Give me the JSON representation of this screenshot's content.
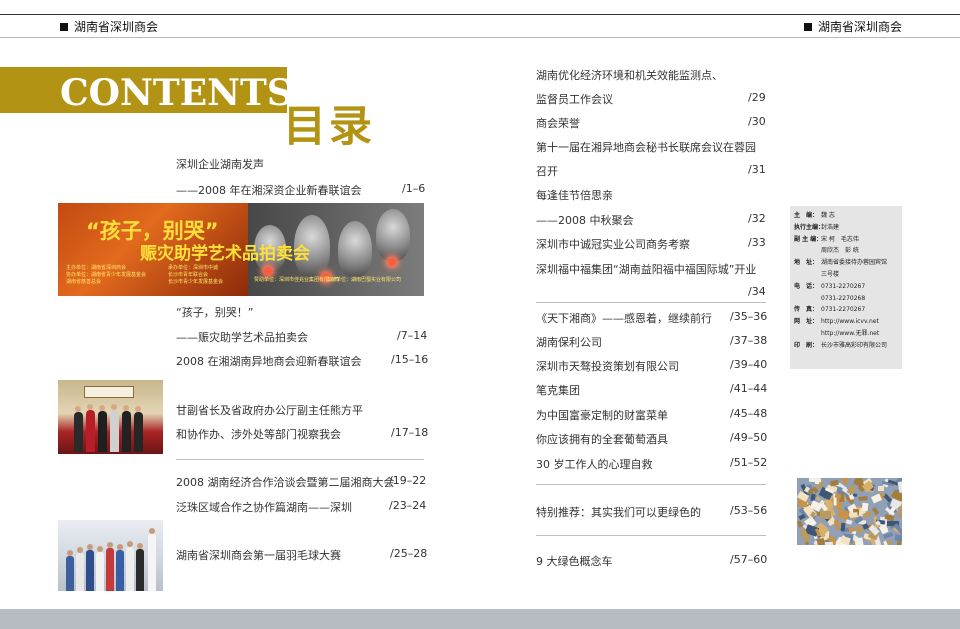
{
  "header": {
    "left_title": "湖南省深圳商会",
    "right_title": "湖南省深圳商会"
  },
  "title": {
    "contents": "CONTENTS",
    "mulu": "目录"
  },
  "left_entries": [
    {
      "title": "深圳企业湖南发声",
      "page": ""
    },
    {
      "title": "——2008 年在湘深资企业新春联谊会",
      "page": "/1–6"
    },
    {
      "title": "“孩子，别哭！”",
      "page": ""
    },
    {
      "title": "——赈灾助学艺术品拍卖会",
      "page": "/7–14"
    },
    {
      "title": "2008 在湘湖南异地商会迎新春联谊会",
      "page": "/15–16"
    },
    {
      "title": "甘副省长及省政府办公厅副主任熊方平",
      "page": ""
    },
    {
      "title": "和协作办、涉外处等部门视察我会",
      "page": "/17–18"
    },
    {
      "title": "2008 湖南经济合作洽谈会暨第二届湘商大会",
      "page": "/19–22"
    },
    {
      "title": "泛珠区域合作之协作篇湖南——深圳",
      "page": "/23–24"
    },
    {
      "title": "湖南省深圳商会第一届羽毛球大赛",
      "page": "/25–28"
    }
  ],
  "right_entries": [
    {
      "title": "湖南优化经济环境和机关效能监测点、",
      "page": ""
    },
    {
      "title": "监督员工作会议",
      "page": "/29"
    },
    {
      "title": "商会荣誉",
      "page": "/30"
    },
    {
      "title": "第十一届在湘异地商会秘书长联席会议在蓉园",
      "page": ""
    },
    {
      "title": "召开",
      "page": "/31"
    },
    {
      "title": "每逢佳节倍思亲",
      "page": ""
    },
    {
      "title": "——2008 中秋聚会",
      "page": "/32"
    },
    {
      "title": "深圳市中诚冠实业公司商务考察",
      "page": "/33"
    },
    {
      "title": "深圳福中福集团“湖南益阳福中福国际城”开业",
      "page": ""
    },
    {
      "title": "",
      "page": "/34"
    },
    {
      "title": "《天下湘商》——感恩着，继续前行",
      "page": "/35–36"
    },
    {
      "title": "湖南保利公司",
      "page": "/37–38"
    },
    {
      "title": "深圳市天骜投资策划有限公司",
      "page": "/39–40"
    },
    {
      "title": "笔克集团",
      "page": "/41–44"
    },
    {
      "title": "为中国富豪定制的财富菜单",
      "page": "/45–48"
    },
    {
      "title": "你应该拥有的全套葡萄酒具",
      "page": "/49–50"
    },
    {
      "title": "30 岁工作人的心理自救",
      "page": "/51–52"
    },
    {
      "title": "特别推荐：其实我们可以更绿色的",
      "page": "/53–56"
    },
    {
      "title": "9 大绿色概念车",
      "page": "/57–60"
    }
  ],
  "banner": {
    "line1": "“孩子，别哭”",
    "line2": "赈灾助学艺术品拍卖会",
    "small_left": [
      "主办单位：湖南省深圳商会",
      "协办单位：湖南省青少年发展基金会",
      "湖南省慈善总会"
    ],
    "small_mid": [
      "承办单位：深圳市中诚",
      "长沙市青年联合会",
      "长沙市青少年发展基金会"
    ],
    "small_mid2": [
      "赞助单位：深圳市佳兆业集团有限公司"
    ],
    "small_right": [
      "支持单位：湖南巴蜀实业有限公司"
    ]
  },
  "credits": [
    {
      "k": "主　编：",
      "v": "魏 志"
    },
    {
      "k": "执行主编：",
      "v": "封浩建"
    },
    {
      "k": "副 主 编：",
      "v": "宋 柯　毛志伟"
    },
    {
      "k": "",
      "v": "周欣杰　彭 统"
    },
    {
      "k": "地　址：",
      "v": "湖南省委接待办蓉园宾馆"
    },
    {
      "k": "",
      "v": "三号楼"
    },
    {
      "k": "电　话：",
      "v": "0731-2270267"
    },
    {
      "k": "",
      "v": "0731-2270268"
    },
    {
      "k": "传　真：",
      "v": "0731-2270267"
    },
    {
      "k": "网　址：",
      "v": "http://www.icvv.net"
    },
    {
      "k": "",
      "v": "http://www.无罪.net"
    },
    {
      "k": "印　刷：",
      "v": "长沙市雅高彩印有限公司"
    }
  ],
  "colors": {
    "accent": "#b39313",
    "footer": "#b7bcc3",
    "credits_bg": "#e5e5e5"
  }
}
